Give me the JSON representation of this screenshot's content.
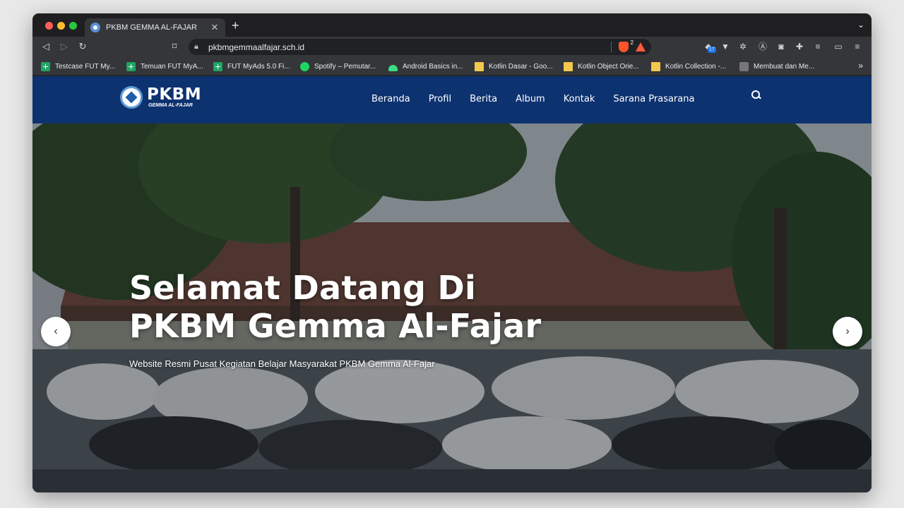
{
  "browser": {
    "tab_title": "PKBM GEMMA AL-FAJAR",
    "tab_close": "✕",
    "new_tab": "+",
    "tab_menu": "⌄",
    "url": "pkbmgemmaalfajar.sch.id",
    "brave_badge": "2",
    "extension_badge": "17",
    "bookmarks": [
      {
        "label": "Testcase FUT My...",
        "icon": "sheets-icon"
      },
      {
        "label": "Temuan FUT MyA...",
        "icon": "sheets-icon"
      },
      {
        "label": "FUT MyAds 5.0 Fi...",
        "icon": "sheets-icon"
      },
      {
        "label": "Spotify – Pemutar...",
        "icon": "spotify-icon"
      },
      {
        "label": "Android Basics in...",
        "icon": "android-icon"
      },
      {
        "label": "Kotlin Dasar - Goo...",
        "icon": "folder-icon"
      },
      {
        "label": "Kotlin Object Orie...",
        "icon": "folder-icon"
      },
      {
        "label": "Kotlin Collection -...",
        "icon": "folder-icon"
      },
      {
        "label": "Membuat dan Me...",
        "icon": "image-icon"
      }
    ],
    "bookmarks_more": "»"
  },
  "site": {
    "logo_main": "PKBM",
    "logo_sub": "GEMMA AL-FAJAR",
    "menu": [
      "Beranda",
      "Profil",
      "Berita",
      "Album",
      "Kontak",
      "Sarana Prasarana"
    ],
    "hero": {
      "title_line1": "Selamat Datang Di",
      "title_line2": "PKBM Gemma Al-Fajar",
      "subtitle": "Website Resmi Pusat Kegiatan Belajar Masyarakat PKBM Gemma Al-Fajar",
      "prev": "‹",
      "next": "›"
    }
  },
  "colors": {
    "nav_bg": "#0d3270",
    "browser_chrome": "#35363a",
    "tab_strip": "#1f1f22"
  }
}
